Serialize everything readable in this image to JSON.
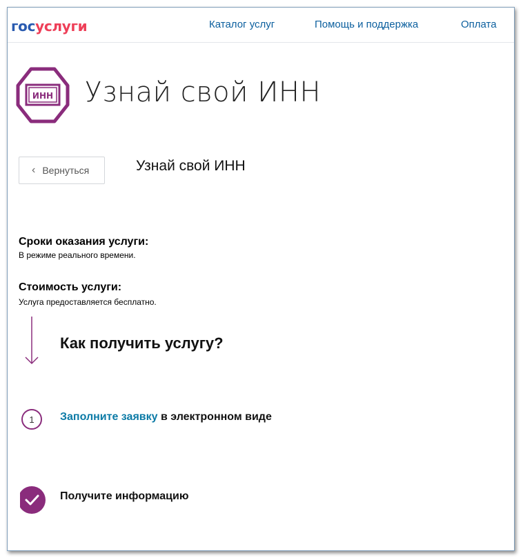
{
  "header": {
    "logo_gos": "гос",
    "logo_uslugi": "услуги",
    "nav": [
      "Каталог услуг",
      "Помощь и поддержка",
      "Оплата"
    ]
  },
  "service": {
    "badge_text": "ИНН",
    "title": "Узнай свой ИНН",
    "subtitle": "Узнай свой ИНН",
    "back_label": "Вернуться"
  },
  "info": {
    "terms_label": "Сроки оказания услуги:",
    "terms_value": "В режиме реального времени.",
    "cost_label": "Стоимость услуги:",
    "cost_value": "Услуга предоставляется бесплатно."
  },
  "how": {
    "title": "Как получить услугу?",
    "steps": [
      {
        "number": "1",
        "link": "Заполните заявку",
        "rest": " в электронном виде"
      },
      {
        "text": "Получите информацию"
      }
    ]
  },
  "colors": {
    "accent_purple": "#8a2c7c",
    "link_blue": "#0b7aa6",
    "nav_blue": "#0b5f9e",
    "logo_red": "#ee3f58",
    "logo_blue": "#2a5bb0"
  }
}
